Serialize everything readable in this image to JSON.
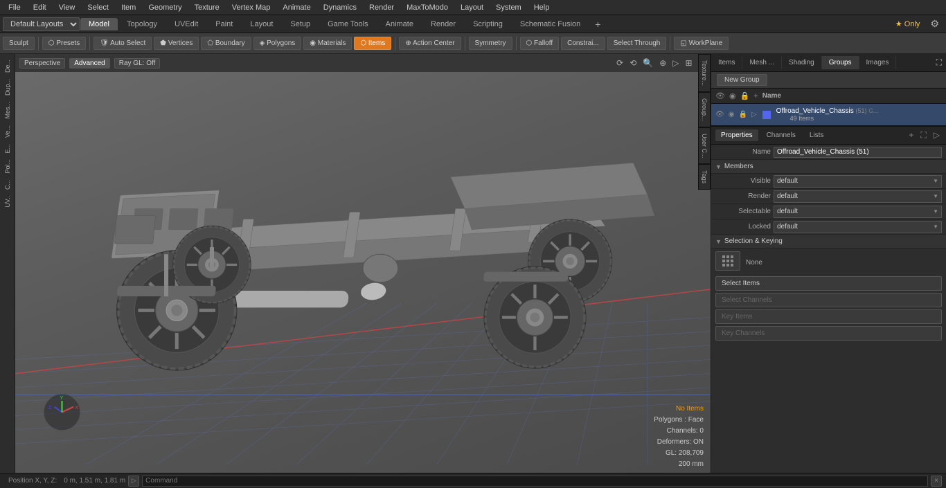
{
  "menu": {
    "items": [
      "File",
      "Edit",
      "View",
      "Select",
      "Item",
      "Geometry",
      "Texture",
      "Vertex Map",
      "Animate",
      "Dynamics",
      "Render",
      "MaxToModo",
      "Layout",
      "System",
      "Help"
    ]
  },
  "layout_bar": {
    "dropdown": "Default Layouts ▾",
    "tabs": [
      "Model",
      "Topology",
      "UVEdit",
      "Paint",
      "Layout",
      "Setup",
      "Game Tools",
      "Animate",
      "Render",
      "Scripting",
      "Schematic Fusion"
    ],
    "active_tab": "Model",
    "star_label": "★ Only",
    "plus_label": "+",
    "gear_label": "⚙"
  },
  "toolbar": {
    "sculpt": "Sculpt",
    "presets": "Presets",
    "auto_select": "Auto Select",
    "vertices": "Vertices",
    "boundary": "Boundary",
    "polygons": "Polygons",
    "materials": "Materials",
    "items": "Items",
    "action_center": "Action Center",
    "symmetry": "Symmetry",
    "falloff": "Falloff",
    "constraints": "Constrai...",
    "select_through": "Select Through",
    "workplane": "WorkPlane"
  },
  "viewport": {
    "perspective": "Perspective",
    "advanced": "Advanced",
    "ray_gl": "Ray GL: Off",
    "icons": [
      "⟳",
      "⟲",
      "🔍",
      "⊕",
      "▷",
      "⊞"
    ]
  },
  "viewport_status": {
    "no_items": "No Items",
    "polygons": "Polygons : Face",
    "channels": "Channels: 0",
    "deformers": "Deformers: ON",
    "gl": "GL: 208,709",
    "size": "200 mm"
  },
  "left_sidebar": {
    "items": [
      "De...",
      "Dup...",
      "Mes...",
      "Ve...",
      "E...",
      "Pol...",
      "C...",
      "UV.."
    ]
  },
  "right_panel": {
    "tabs": [
      "Items",
      "Mesh ...",
      "Shading",
      "Groups",
      "Images"
    ],
    "active_tab": "Groups",
    "new_group_label": "New Group",
    "col_names": [
      "Name"
    ],
    "group": {
      "name": "Offroad_Vehicle_Chassis",
      "count": "(51)",
      "sub_count": "49 Items"
    }
  },
  "properties": {
    "tabs": [
      "Properties",
      "Channels",
      "Lists"
    ],
    "active_tab": "Properties",
    "plus_label": "+",
    "name_label": "Name",
    "name_value": "Offroad_Vehicle_Chassis (51)",
    "members_label": "Members",
    "visible_label": "Visible",
    "visible_value": "default",
    "render_label": "Render",
    "render_value": "default",
    "selectable_label": "Selectable",
    "selectable_value": "default",
    "locked_label": "Locked",
    "locked_value": "default",
    "sel_key_label": "Selection & Keying",
    "none_label": "None",
    "select_items": "Select Items",
    "select_channels": "Select Channels",
    "key_items": "Key Items",
    "key_channels": "Key Channels"
  },
  "right_edge_tabs": [
    "Texture...",
    "Group...",
    "User C...",
    "Tags"
  ],
  "bottom_bar": {
    "pos_label": "Position X, Y, Z:",
    "pos_value": "0 m, 1.51 m, 1.81 m",
    "command_label": "Command",
    "toggle": "▷"
  }
}
